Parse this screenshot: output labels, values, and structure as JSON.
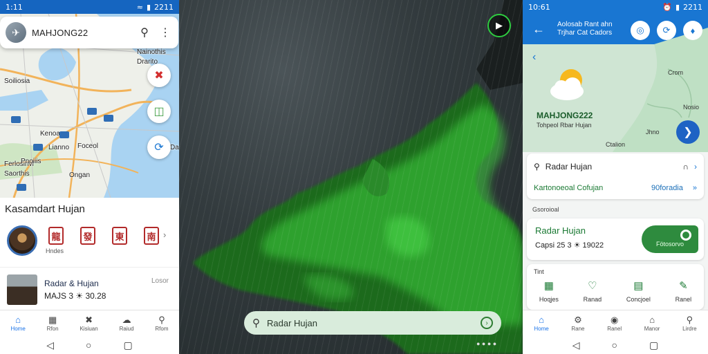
{
  "left": {
    "status": {
      "time": "1:11",
      "right": "2211"
    },
    "app_title": "MAHJONG22",
    "map_labels": [
      "Nainothis",
      "Drarito",
      "Soiliosia",
      "Kenoa",
      "Foceol",
      "Lianno",
      "Ferlosinvl",
      "Saorthis",
      "Pnoiiis",
      "Ongan",
      "Da"
    ],
    "sheet_title": "Kasamdart Hujan",
    "kanji": [
      "龍",
      "發",
      "東",
      "南"
    ],
    "kanji_caption": "Hndes",
    "card": {
      "title": "Radar & Hujan",
      "subtitle": "MAJS 3 ☀ 30.28",
      "more": "Losor"
    },
    "tabs": [
      "Home",
      "Rfon",
      "Kisiuan",
      "Raiud",
      "Rfom"
    ]
  },
  "middle": {
    "search_placeholder": "Radar Hujan",
    "credit": "● ● ● ●"
  },
  "right": {
    "status": {
      "time": "10:61",
      "right": "2211"
    },
    "header_title_1": "Aolosab Rant ahn",
    "header_title_2": "Trjhar Cat Cadors",
    "brand": "MAHJONG222",
    "brand_sub": "Tohpeol Rbar Hujan",
    "map_labels": [
      "Crom",
      "Nosio",
      "Ctalion",
      "Jhno"
    ],
    "row1_label": "Radar Hujan",
    "row2_label": "Kartonoeoal Cofujan",
    "row2_value": "90foradia",
    "section_label": "Gsoroioal",
    "card_title": "Radar Hujan",
    "card_sub": "Capsi 25 3 ☀ 19022",
    "pill_label": "Fötosorvo",
    "grid_header": "Tint",
    "grid": [
      "Hoqjes",
      "Ranad",
      "Concjoel",
      "Ranel"
    ],
    "tabs": [
      "Home",
      "Rane",
      "Ranel",
      "Manor",
      "Lirdre"
    ]
  }
}
